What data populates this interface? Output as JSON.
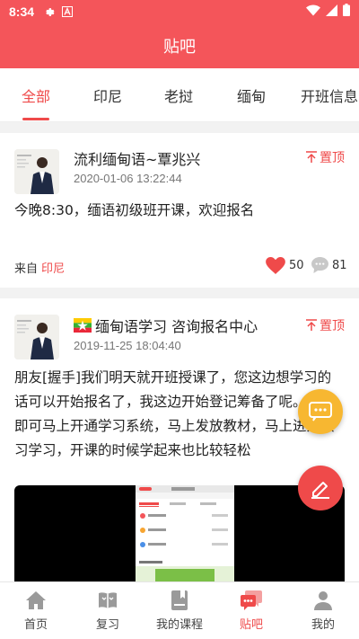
{
  "status_bar": {
    "time": "8:34"
  },
  "header": {
    "title": "贴吧"
  },
  "tabs": [
    {
      "label": "全部"
    },
    {
      "label": "印尼"
    },
    {
      "label": "老挝"
    },
    {
      "label": "缅甸"
    },
    {
      "label": "开班信息"
    }
  ],
  "posts": [
    {
      "author": "流利缅甸语~覃兆兴",
      "date": "2020-01-06 13:22:44",
      "pin_label": "置顶",
      "content": "今晚8:30，缅语初级班开课，欢迎报名",
      "from_label": "来自",
      "category": "印尼",
      "likes": "50",
      "comments": "81"
    },
    {
      "author": "缅甸语学习 咨询报名中心",
      "date": "2019-11-25 18:04:40",
      "pin_label": "置顶",
      "content": "朋友[握手]我们明天就开班授课了，您这边想学习的话可以开始报名了，我这边开始登记筹备了呢。报名即可马上开通学习系统，马上发放教材，马上进入预习学习，开课的时候学起来也比较轻松"
    }
  ],
  "bottom_nav": [
    {
      "label": "首页",
      "icon": "home-icon"
    },
    {
      "label": "复习",
      "icon": "book-open-icon"
    },
    {
      "label": "我的课程",
      "icon": "course-book-icon"
    },
    {
      "label": "贴吧",
      "icon": "chat-bubble-icon"
    },
    {
      "label": "我的",
      "icon": "person-icon"
    }
  ],
  "colors": {
    "primary": "#f4555a",
    "accent_red": "#ef4a4a",
    "fab_yellow": "#f7b731"
  }
}
